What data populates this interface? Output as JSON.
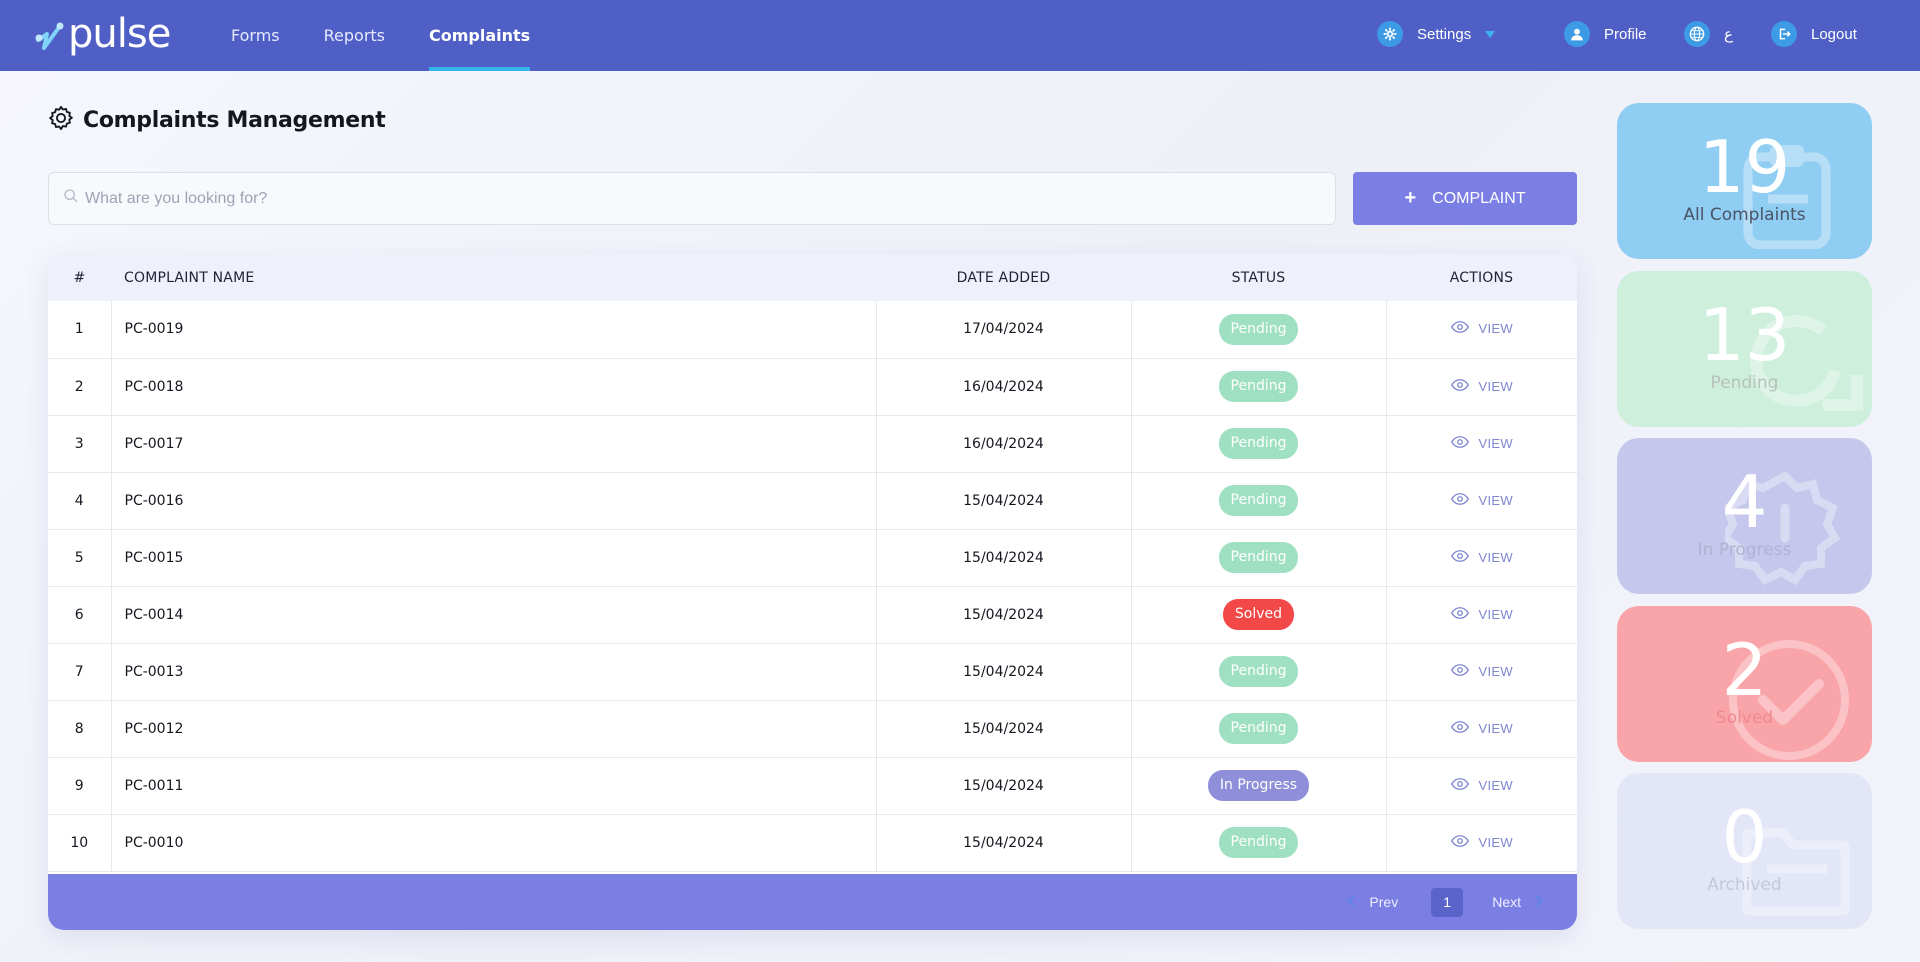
{
  "header": {
    "logo_text": "pulse",
    "nav": [
      {
        "label": "Forms",
        "active": false
      },
      {
        "label": "Reports",
        "active": false
      },
      {
        "label": "Complaints",
        "active": true
      }
    ],
    "settings_label": "Settings",
    "profile_label": "Profile",
    "language_label": "ع",
    "logout_label": "Logout"
  },
  "page": {
    "title": "Complaints Management"
  },
  "search": {
    "placeholder": "What are you looking for?",
    "value": ""
  },
  "add_button": {
    "icon": "+",
    "label": "COMPLAINT"
  },
  "table": {
    "columns": [
      "#",
      "COMPLAINT NAME",
      "DATE ADDED",
      "STATUS",
      "ACTIONS"
    ],
    "rows": [
      {
        "num": "1",
        "name": "PC-0019",
        "date": "17/04/2024",
        "status": "Pending",
        "action": "VIEW"
      },
      {
        "num": "2",
        "name": "PC-0018",
        "date": "16/04/2024",
        "status": "Pending",
        "action": "VIEW"
      },
      {
        "num": "3",
        "name": "PC-0017",
        "date": "16/04/2024",
        "status": "Pending",
        "action": "VIEW"
      },
      {
        "num": "4",
        "name": "PC-0016",
        "date": "15/04/2024",
        "status": "Pending",
        "action": "VIEW"
      },
      {
        "num": "5",
        "name": "PC-0015",
        "date": "15/04/2024",
        "status": "Pending",
        "action": "VIEW"
      },
      {
        "num": "6",
        "name": "PC-0014",
        "date": "15/04/2024",
        "status": "Solved",
        "action": "VIEW"
      },
      {
        "num": "7",
        "name": "PC-0013",
        "date": "15/04/2024",
        "status": "Pending",
        "action": "VIEW"
      },
      {
        "num": "8",
        "name": "PC-0012",
        "date": "15/04/2024",
        "status": "Pending",
        "action": "VIEW"
      },
      {
        "num": "9",
        "name": "PC-0011",
        "date": "15/04/2024",
        "status": "In Progress",
        "action": "VIEW"
      },
      {
        "num": "10",
        "name": "PC-0010",
        "date": "15/04/2024",
        "status": "Pending",
        "action": "VIEW"
      }
    ]
  },
  "pagination": {
    "prev_label": "Prev",
    "current_page": "1",
    "next_label": "Next"
  },
  "status_colors": {
    "Pending": "#9fe0c2",
    "Solved": "#f24848",
    "In Progress": "#8f8ed8"
  },
  "stats": [
    {
      "value": "19",
      "label": "All Complaints",
      "color": "#8fcdf2",
      "label_color": "#4a5366",
      "icon": "clipboard-icon"
    },
    {
      "value": "13",
      "label": "Pending",
      "color": "#cdefdc",
      "label_color": "#b7c2bc",
      "icon": "refresh-icon"
    },
    {
      "value": "4",
      "label": "In Progress",
      "color": "#c5c8ec",
      "label_color": "#b0b3d2",
      "icon": "alert-badge-icon"
    },
    {
      "value": "2",
      "label": "Solved",
      "color": "#f9a4a8",
      "label_color": "#f08a90",
      "icon": "check-circle-icon"
    },
    {
      "value": "0",
      "label": "Archived",
      "color": "#e2e6f6",
      "label_color": "#c4c8da",
      "icon": "folder-icon"
    }
  ]
}
